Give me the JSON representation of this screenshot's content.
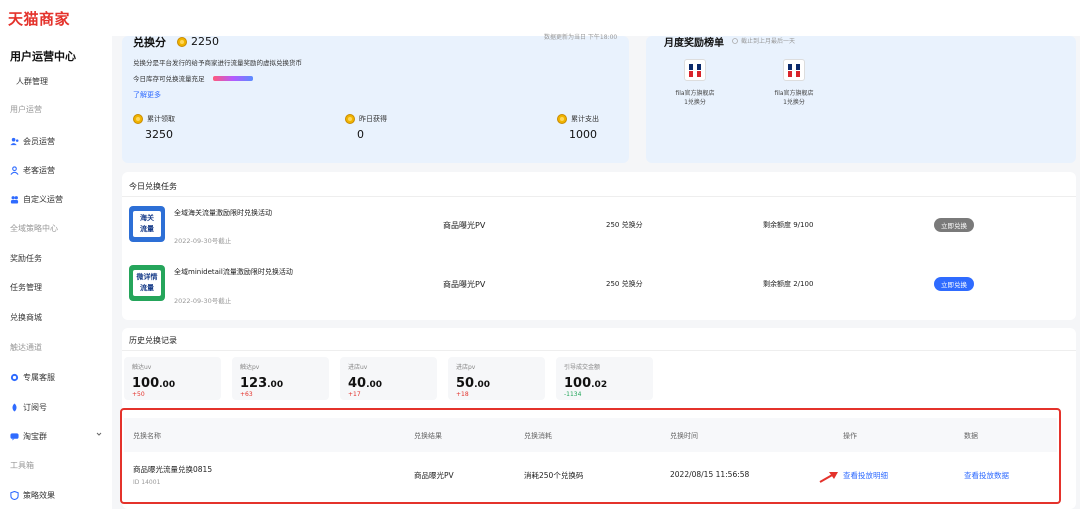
{
  "brand": {
    "logo": "天猫商家"
  },
  "sidebar": {
    "title": "用户运营中心",
    "items": [
      {
        "label": "人群管理",
        "style": "indent"
      },
      {
        "label": "用户运营",
        "style": "muted"
      },
      {
        "label": "会员运营",
        "icon": "members-icon"
      },
      {
        "label": "老客运营",
        "icon": "returning-customer-icon"
      },
      {
        "label": "自定义运营",
        "icon": "custom-icon"
      },
      {
        "label": "全域策略中心",
        "style": "muted"
      },
      {
        "label": "奖励任务"
      },
      {
        "label": "任务管理"
      },
      {
        "label": "兑换商城"
      },
      {
        "label": "触达通道",
        "style": "muted"
      },
      {
        "label": "专属客服",
        "icon": "service-icon"
      },
      {
        "label": "订阅号",
        "icon": "subscription-icon"
      },
      {
        "label": "淘宝群",
        "icon": "group-icon"
      },
      {
        "label": "工具箱",
        "style": "muted"
      },
      {
        "label": "策略效果",
        "icon": "strategy-icon"
      }
    ]
  },
  "exchange": {
    "title": "兑换分",
    "value": "2250",
    "update_note": "数据更新为当日 下午18:00",
    "description": "兑换分是平台发行的给予商家进行流量奖励的虚拟兑换货币",
    "stock_text": "今日库存可兑换流量充足",
    "learn_more": "了解更多",
    "stats": [
      {
        "label": "累计领取",
        "value": "3250"
      },
      {
        "label": "昨日获得",
        "value": "0"
      },
      {
        "label": "累计支出",
        "value": "1000"
      }
    ]
  },
  "ranking": {
    "title": "月度奖励榜单",
    "note": "截止到上月最后一天",
    "shops": [
      {
        "name": "fila官方旗舰店",
        "score": "1兑换分"
      },
      {
        "name": "fila官方旗舰店",
        "score": "1兑换分"
      }
    ]
  },
  "tasks": {
    "title": "今日兑换任务",
    "rows": [
      {
        "thumb": [
          "海关",
          "流量"
        ],
        "name": "全域海关流量激励限时兑换活动",
        "deadline": "2022-09-30号截止",
        "type": "商品曝光PV",
        "cost": "250 兑换分",
        "quota": "剩余额度 9/100",
        "button": "立即兑换"
      },
      {
        "thumb": [
          "微详情",
          "流量"
        ],
        "name": "全域minidetail流量激励限时兑换活动",
        "deadline": "2022-09-30号截止",
        "type": "商品曝光PV",
        "cost": "250 兑换分",
        "quota": "剩余额度 2/100",
        "button": "立即兑换"
      }
    ]
  },
  "history": {
    "title": "历史兑换记录",
    "tiles": [
      {
        "label": "触达uv",
        "int": "100",
        "dec": ".00",
        "delta": "+50"
      },
      {
        "label": "触达pv",
        "int": "123",
        "dec": ".00",
        "delta": "+63"
      },
      {
        "label": "进店uv",
        "int": "40",
        "dec": ".00",
        "delta": "+17"
      },
      {
        "label": "进店pv",
        "int": "50",
        "dec": ".00",
        "delta": "+18"
      },
      {
        "label": "引导成交金额",
        "int": "100",
        "dec": ".02",
        "delta": "-1134"
      }
    ],
    "columns": [
      "兑换名称",
      "兑换结果",
      "兑换消耗",
      "兑换时间",
      "操作",
      "数据"
    ],
    "row": {
      "name": "商品曝光流量兑换0815",
      "id": "ID 14001",
      "result": "商品曝光PV",
      "cost": "消耗250个兑换码",
      "time": "2022/08/15 11:56:58",
      "action": "查看投放明细",
      "data": "查看投放数据"
    }
  },
  "colors": {
    "accent": "#2f6bff",
    "brand": "#e4322b",
    "highlight_frame": "#e4322b"
  }
}
